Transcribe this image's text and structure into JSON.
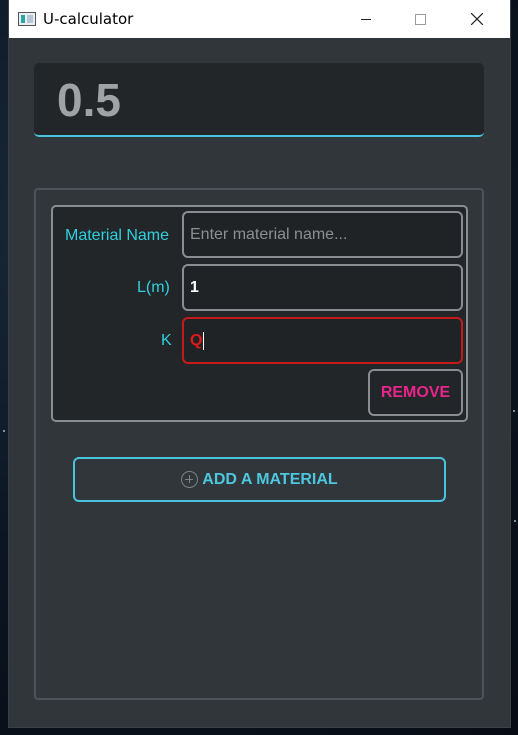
{
  "window": {
    "title": "U-calculator"
  },
  "display": {
    "value": "0.5"
  },
  "material": {
    "name_label": "Material Name",
    "name_placeholder": "Enter material name...",
    "l_label": "L(m)",
    "l_value": "1",
    "k_label": "K",
    "k_value": "Q",
    "remove_label": "REMOVE"
  },
  "add_button": {
    "label": "ADD A MATERIAL"
  },
  "colors": {
    "accent": "#48c4dc",
    "label": "#2fd0de",
    "error": "#c41a1a",
    "remove": "#e8258a",
    "background": "#31363a"
  },
  "icons": {
    "add": "plus-circle-icon",
    "close": "close-icon",
    "minimize": "minimize-icon",
    "maximize": "maximize-icon",
    "app": "app-icon"
  }
}
